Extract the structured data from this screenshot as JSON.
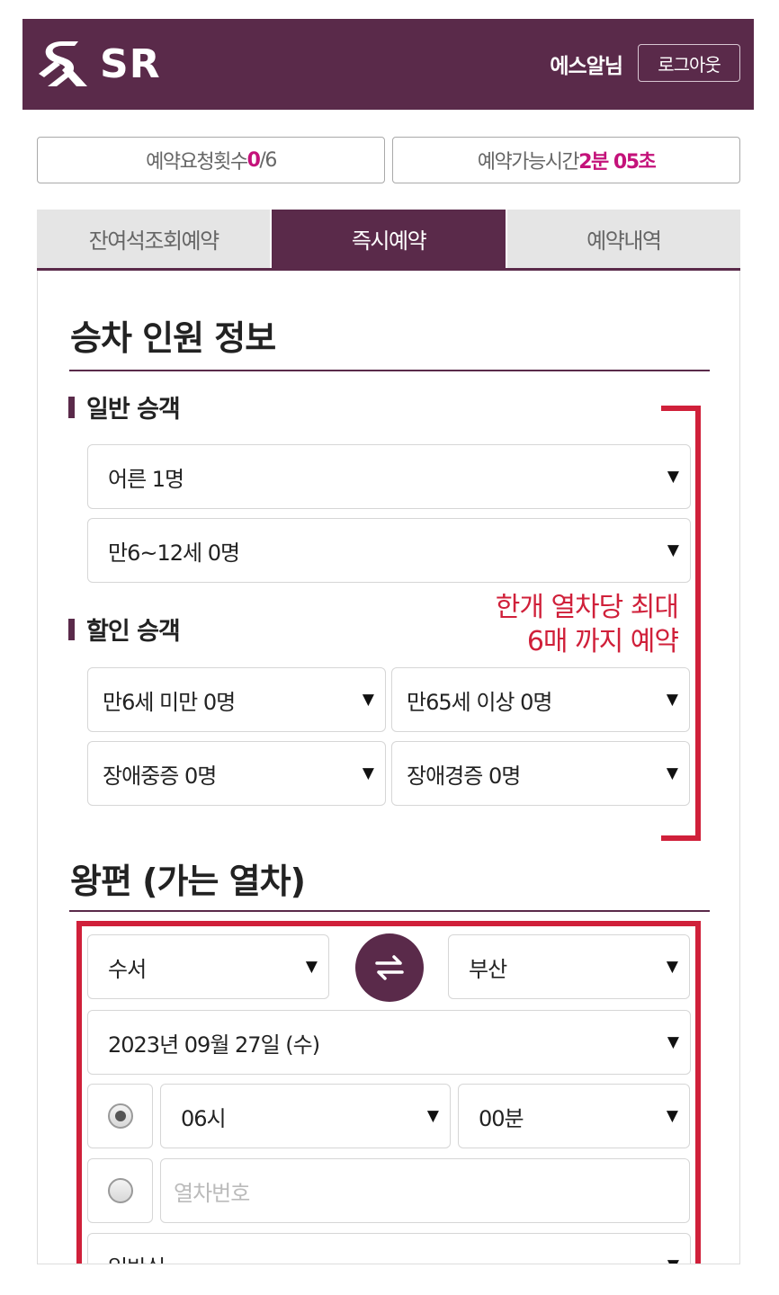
{
  "header": {
    "logo_text": "SR",
    "user_name": "에스알님",
    "logout_label": "로그아웃"
  },
  "status": {
    "request_count_label": "예약요청횟수 ",
    "request_count_value": "0",
    "request_count_max": "/6",
    "time_left_label": "예약가능시간 ",
    "time_left_value": "2분 05초"
  },
  "tabs": [
    {
      "label": "잔여석조회예약",
      "active": false
    },
    {
      "label": "즉시예약",
      "active": true
    },
    {
      "label": "예약내역",
      "active": false
    }
  ],
  "passenger_section": {
    "title": "승차 인원 정보",
    "general_title": "일반 승객",
    "general": [
      "어른 1명",
      "만6~12세 0명"
    ],
    "discount_title": "할인 승객",
    "discount": [
      "만6세 미만 0명",
      "만65세 이상 0명",
      "장애중증 0명",
      "장애경증 0명"
    ],
    "note_line1": "한개 열차당 최대",
    "note_line2": "6매 까지 예약"
  },
  "trip_section": {
    "title": "왕편 (가는 열차)",
    "departure": "수서",
    "arrival": "부산",
    "date": "2023년 09월 27일 (수)",
    "hour": "06시",
    "minute": "00분",
    "train_number_placeholder": "열차번호",
    "seat_type": "일반실",
    "selected_mode": "time"
  },
  "icons": {
    "dropdown": "▼",
    "swap": "swap-arrows-icon"
  },
  "colors": {
    "brand": "#5a2a4a",
    "accent": "#c4127a",
    "highlight_red": "#d0203a"
  }
}
